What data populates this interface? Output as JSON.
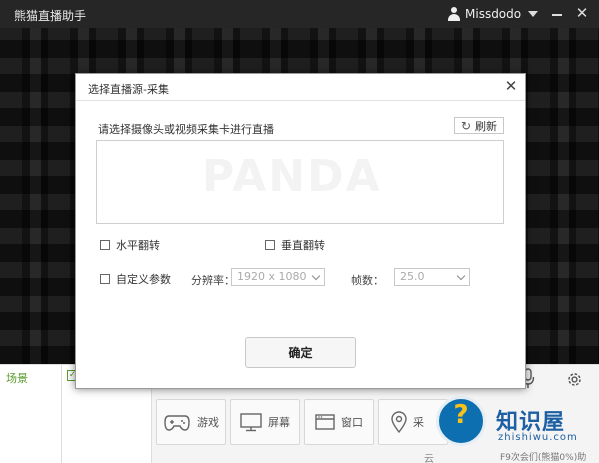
{
  "app": {
    "title": "熊猫直播助手",
    "username": "Missdodo"
  },
  "bottom": {
    "scene_label": "场景",
    "source_buttons": [
      {
        "label": "游戏",
        "icon": "gamepad-icon"
      },
      {
        "label": "屏幕",
        "icon": "monitor-icon"
      },
      {
        "label": "窗口",
        "icon": "window-icon"
      },
      {
        "label": "采",
        "icon": "location-pin-icon"
      }
    ],
    "footer_left": "云",
    "footer_right": "F9次会们(熊猫0%)助"
  },
  "dialog": {
    "title": "选择直播源-采集",
    "prompt": "请选择摄像头或视频采集卡进行直播",
    "refresh_label": "刷新",
    "horizontal_flip_label": "水平翻转",
    "vertical_flip_label": "垂直翻转",
    "custom_params_label": "自定义参数",
    "resolution_label": "分辨率：",
    "resolution_value": "1920 x 1080",
    "fps_label": "帧数：",
    "fps_value": "25.0",
    "ok_label": "确定"
  },
  "watermark": {
    "title": "知识屋",
    "url": "zhishiwu.com"
  },
  "colors": {
    "accent_green": "#5a9b2f",
    "titlebar": "#262626",
    "watermark_blue": "#1d5fa3"
  }
}
